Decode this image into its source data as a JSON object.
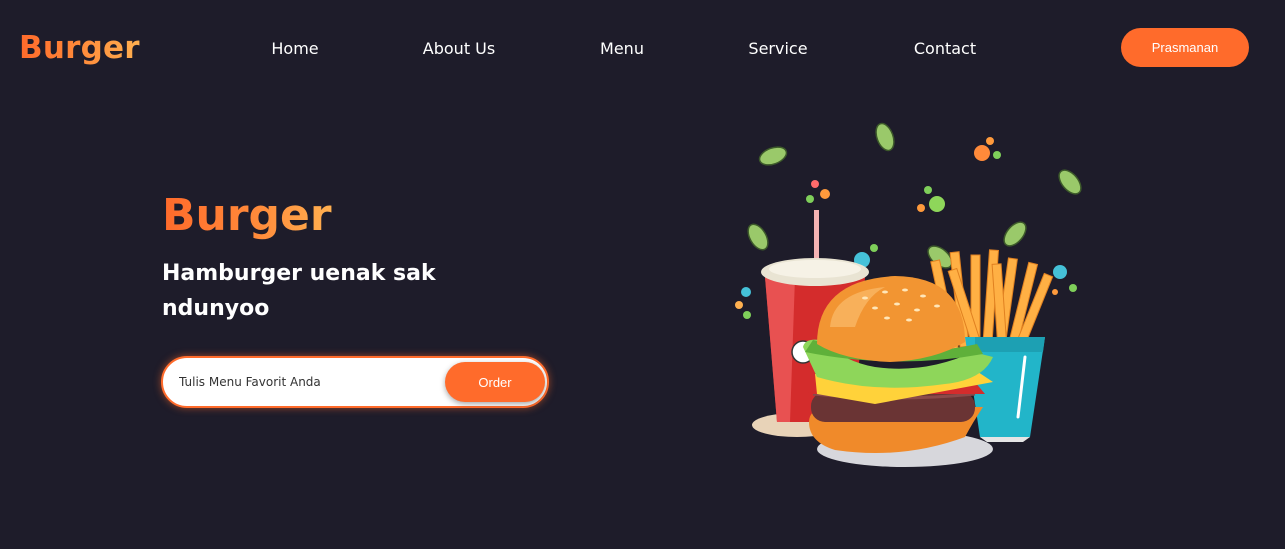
{
  "header": {
    "logo": "Burger",
    "nav": [
      {
        "label": "Home"
      },
      {
        "label": "About Us"
      },
      {
        "label": "Menu"
      },
      {
        "label": "Service"
      },
      {
        "label": "Contact"
      }
    ],
    "cta_label": "Prasmanan"
  },
  "hero": {
    "title": "Burger",
    "subtitle": "Hamburger uenak sak ndunyoo",
    "search": {
      "placeholder": "Tulis Menu Favorit Anda",
      "value": ""
    },
    "order_label": "Order"
  },
  "illustration": {
    "icon": "burger-meal-illustration"
  },
  "colors": {
    "background": "#1e1c2a",
    "accent": "#ff6b2b",
    "accent_light": "#ffb050",
    "text": "#ffffff"
  }
}
